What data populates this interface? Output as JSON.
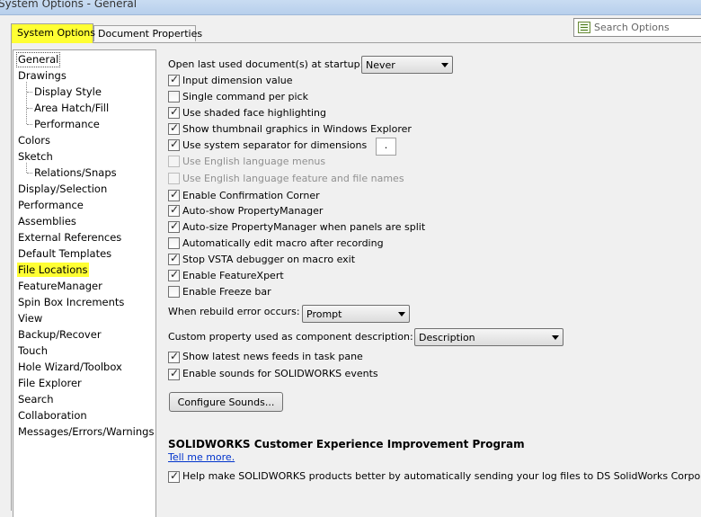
{
  "window": {
    "title": "System Options - General"
  },
  "tabs": [
    {
      "label": "System Options",
      "active": true
    },
    {
      "label": "Document Properties",
      "active": false
    }
  ],
  "search": {
    "placeholder": "Search Options",
    "icon": "search-options-icon"
  },
  "tree": {
    "items": [
      {
        "label": "General",
        "level": 0,
        "selected": true
      },
      {
        "label": "Drawings",
        "level": 0
      },
      {
        "label": "Display Style",
        "level": 1
      },
      {
        "label": "Area Hatch/Fill",
        "level": 1
      },
      {
        "label": "Performance",
        "level": 1
      },
      {
        "label": "Colors",
        "level": 0
      },
      {
        "label": "Sketch",
        "level": 0
      },
      {
        "label": "Relations/Snaps",
        "level": 1
      },
      {
        "label": "Display/Selection",
        "level": 0
      },
      {
        "label": "Performance",
        "level": 0
      },
      {
        "label": "Assemblies",
        "level": 0
      },
      {
        "label": "External References",
        "level": 0
      },
      {
        "label": "Default Templates",
        "level": 0
      },
      {
        "label": "File Locations",
        "level": 0,
        "highlighted": true
      },
      {
        "label": "FeatureManager",
        "level": 0
      },
      {
        "label": "Spin Box Increments",
        "level": 0
      },
      {
        "label": "View",
        "level": 0
      },
      {
        "label": "Backup/Recover",
        "level": 0
      },
      {
        "label": "Touch",
        "level": 0
      },
      {
        "label": "Hole Wizard/Toolbox",
        "level": 0
      },
      {
        "label": "File Explorer",
        "level": 0
      },
      {
        "label": "Search",
        "level": 0
      },
      {
        "label": "Collaboration",
        "level": 0
      },
      {
        "label": "Messages/Errors/Warnings",
        "level": 0
      }
    ]
  },
  "general": {
    "open_last_label": "Open last used document(s) at startup:",
    "open_last_value": "Never",
    "checkboxes_a": [
      {
        "label": "Input dimension value",
        "checked": true,
        "disabled": false
      },
      {
        "label": "Single command per pick",
        "checked": false,
        "disabled": false
      },
      {
        "label": "Use shaded face highlighting",
        "checked": true,
        "disabled": false
      },
      {
        "label": "Show thumbnail graphics in Windows Explorer",
        "checked": true,
        "disabled": false
      },
      {
        "label": "Use system separator for dimensions",
        "checked": true,
        "disabled": false
      },
      {
        "label": "Use English language menus",
        "checked": false,
        "disabled": true
      },
      {
        "label": "Use English language feature and file names",
        "checked": false,
        "disabled": true
      },
      {
        "label": "Enable Confirmation Corner",
        "checked": true,
        "disabled": false
      },
      {
        "label": "Auto-show PropertyManager",
        "checked": true,
        "disabled": false
      },
      {
        "label": "Auto-size PropertyManager when panels are split",
        "checked": true,
        "disabled": false
      },
      {
        "label": "Automatically edit macro after recording",
        "checked": false,
        "disabled": false
      },
      {
        "label": "Stop VSTA debugger on macro exit",
        "checked": true,
        "disabled": false
      },
      {
        "label": "Enable FeatureXpert",
        "checked": true,
        "disabled": false
      },
      {
        "label": "Enable Freeze bar",
        "checked": false,
        "disabled": false
      }
    ],
    "separator_value": ".",
    "rebuild_error_label": "When rebuild error occurs:",
    "rebuild_error_value": "Prompt",
    "custom_prop_label": "Custom property used as component description:",
    "custom_prop_value": "Description",
    "checkboxes_b": [
      {
        "label": "Show latest news feeds in task pane",
        "checked": true
      },
      {
        "label": "Enable sounds for SOLIDWORKS events",
        "checked": true
      }
    ],
    "configure_sounds_label": "Configure Sounds...",
    "ceip_heading": "SOLIDWORKS Customer Experience Improvement Program",
    "ceip_link": "Tell me more.",
    "ceip_checkbox": {
      "label": "Help make SOLIDWORKS products better by automatically sending your log files to DS SolidWorks Corporation",
      "checked": true
    }
  },
  "colors": {
    "highlight": "#ffff33",
    "link": "#0033cc",
    "titlebar": "#c9dcf2"
  }
}
